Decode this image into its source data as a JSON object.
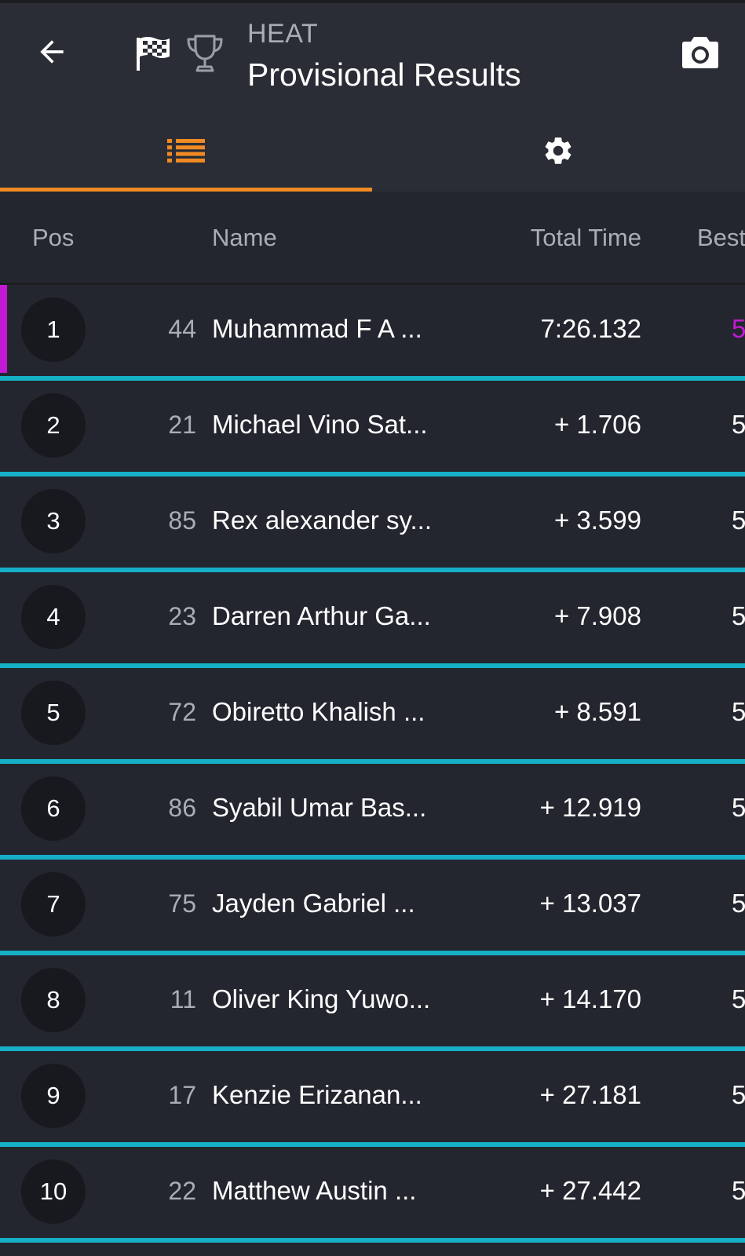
{
  "header": {
    "session_type": "HEAT",
    "title": "Provisional Results",
    "back_icon": "arrow-left-icon",
    "flag_icon": "checkered-flag-icon",
    "trophy_icon": "trophy-icon",
    "camera_icon": "camera-icon"
  },
  "tabs": [
    {
      "name": "list",
      "icon": "list-icon",
      "active": true
    },
    {
      "name": "settings",
      "icon": "gear-icon",
      "active": false
    }
  ],
  "colors": {
    "accent": "#f08a24",
    "row_divider": "#15b0c6",
    "fastest": "#c21ad3",
    "background": "#23262e",
    "header_background": "#2a2d35"
  },
  "columns": {
    "pos": "Pos",
    "name": "Name",
    "total_time": "Total Time",
    "best": "Best"
  },
  "results": [
    {
      "pos": "1",
      "kart": "44",
      "name": "Muhammad F A ...",
      "total": "7:26.132",
      "best": "5",
      "fastest": true
    },
    {
      "pos": "2",
      "kart": "21",
      "name": "Michael Vino Sat...",
      "total": "+ 1.706",
      "best": "5"
    },
    {
      "pos": "3",
      "kart": "85",
      "name": "Rex alexander sy...",
      "total": "+ 3.599",
      "best": "5"
    },
    {
      "pos": "4",
      "kart": "23",
      "name": "Darren Arthur Ga...",
      "total": "+ 7.908",
      "best": "5"
    },
    {
      "pos": "5",
      "kart": "72",
      "name": "Obiretto Khalish ...",
      "total": "+ 8.591",
      "best": "5"
    },
    {
      "pos": "6",
      "kart": "86",
      "name": "Syabil Umar Bas...",
      "total": "+ 12.919",
      "best": "5"
    },
    {
      "pos": "7",
      "kart": "75",
      "name": "Jayden Gabriel ...",
      "total": "+ 13.037",
      "best": "5"
    },
    {
      "pos": "8",
      "kart": "11",
      "name": "Oliver King Yuwo...",
      "total": "+ 14.170",
      "best": "5"
    },
    {
      "pos": "9",
      "kart": "17",
      "name": "Kenzie Erizanan...",
      "total": "+ 27.181",
      "best": "5"
    },
    {
      "pos": "10",
      "kart": "22",
      "name": "Matthew Austin ...",
      "total": "+ 27.442",
      "best": "5"
    }
  ]
}
